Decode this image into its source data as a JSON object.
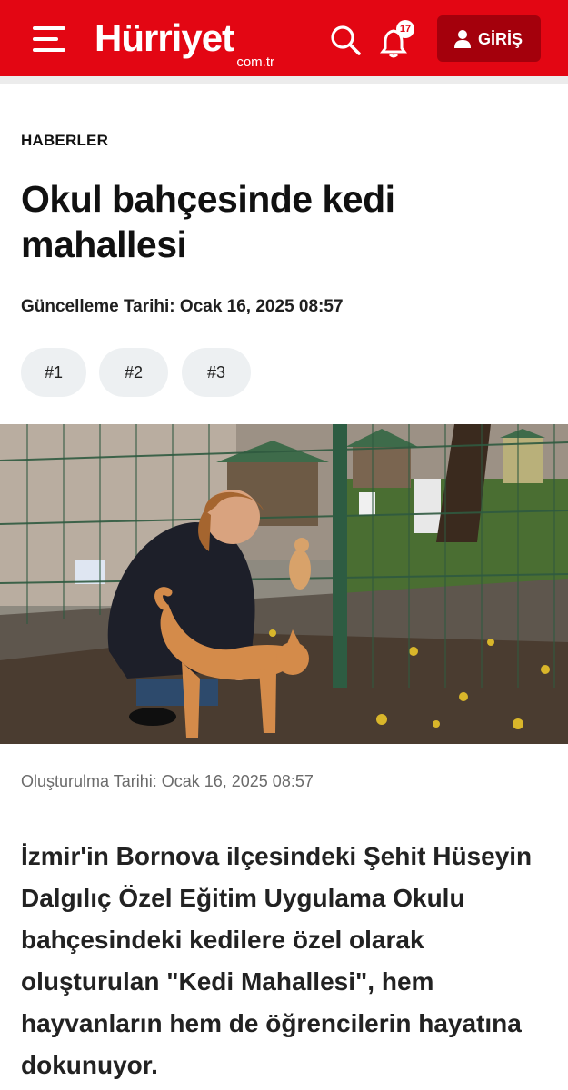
{
  "header": {
    "logo_main": "Hürriyet",
    "logo_sub": "com.tr",
    "notification_count": "17",
    "login_label": "GİRİŞ",
    "brand_color": "#e30613"
  },
  "article": {
    "category": "HABERLER",
    "title": "Okul bahçesinde kedi mahallesi",
    "updated": "Güncelleme Tarihi: Ocak 16, 2025 08:57",
    "tags": [
      "#1",
      "#2",
      "#3"
    ],
    "created": "Oluşturulma Tarihi: Ocak 16, 2025 08:57",
    "lead": "İzmir'in Bornova ilçesindeki Şehit Hüseyin Dalgılıç Özel Eğitim Uygulama Okulu bahçesindeki kedilere özel olarak oluşturulan \"Kedi Mahallesi\", hem hayvanların hem de öğrencilerin hayatına dokunuyor."
  },
  "icons": {
    "menu": "hamburger-icon",
    "search": "search-icon",
    "bell": "bell-icon",
    "user": "user-icon"
  }
}
